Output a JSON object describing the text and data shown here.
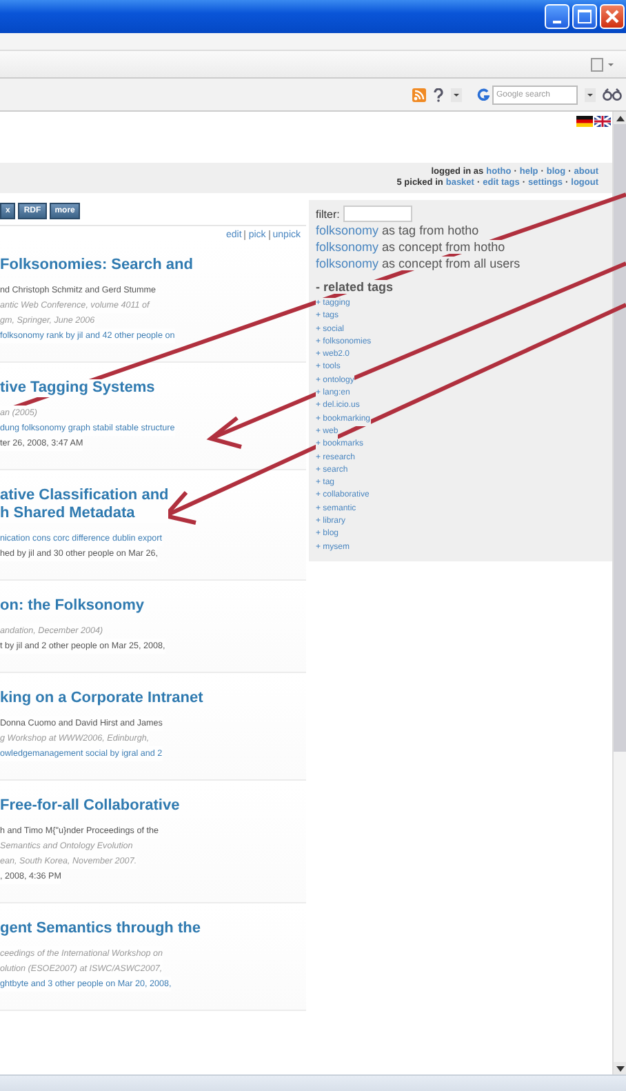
{
  "search": {
    "placeholder": "Google search"
  },
  "user_bar": [
    [
      {
        "text": "logged in as",
        "link": false
      },
      {
        "text": "hotho",
        "link": true
      },
      {
        "text": "·",
        "link": false
      },
      {
        "text": "help",
        "link": true
      },
      {
        "text": "·",
        "link": false
      },
      {
        "text": "blog",
        "link": true
      },
      {
        "text": "·",
        "link": false
      },
      {
        "text": "about",
        "link": true
      }
    ],
    [
      {
        "text": "5 picked in",
        "link": false
      },
      {
        "text": "basket",
        "link": true
      },
      {
        "text": "·",
        "link": false
      },
      {
        "text": "edit tags",
        "link": true
      },
      {
        "text": "·",
        "link": false
      },
      {
        "text": "settings",
        "link": true
      },
      {
        "text": "·",
        "link": false
      },
      {
        "text": "logout",
        "link": true
      }
    ]
  ],
  "export_buttons": [
    "x",
    "RDF",
    "more"
  ],
  "actions": [
    "edit",
    "pick",
    "unpick"
  ],
  "posts": [
    {
      "title": [
        "Folksonomies: Search and"
      ],
      "lines": [
        {
          "kind": "plain",
          "text": "nd Christoph Schmitz and Gerd Stumme"
        },
        {
          "kind": "italic",
          "text": "antic Web Conference, volume 4011 of"
        },
        {
          "kind": "italic",
          "text": "gm, Springer, June 2006"
        },
        {
          "kind": "link",
          "text": "folksonomy rank by jil and 42 other people on"
        }
      ]
    },
    {
      "title": [
        "tive Tagging Systems"
      ],
      "lines": [
        {
          "kind": "italic",
          "text": "an (2005)"
        },
        {
          "kind": "link",
          "text": "dung folksonomy graph stabil stable structure"
        },
        {
          "kind": "plain",
          "text": "ter 26, 2008, 3:47 AM"
        }
      ]
    },
    {
      "title": [
        "ative Classification and",
        "h Shared Metadata"
      ],
      "lines": [
        {
          "kind": "link",
          "text": "nication cons corc difference dublin export"
        },
        {
          "kind": "plain",
          "text": "hed by jil and 30 other people on Mar 26,"
        }
      ]
    },
    {
      "title": [
        "on: the Folksonomy"
      ],
      "lines": [
        {
          "kind": "italic",
          "text": "andation, December 2004)"
        },
        {
          "kind": "plain",
          "text": "t by jil and 2 other people on Mar 25, 2008,"
        }
      ]
    },
    {
      "title": [
        "king on a Corporate Intranet"
      ],
      "lines": [
        {
          "kind": "plain",
          "text": "Donna Cuomo and David Hirst and James"
        },
        {
          "kind": "italic",
          "text": "g Workshop at WWW2006, Edinburgh,"
        },
        {
          "kind": "link",
          "text": "owledgemanagement social by igral and 2"
        }
      ]
    },
    {
      "title": [
        "Free-for-all Collaborative"
      ],
      "lines": [
        {
          "kind": "plain",
          "text": "h and Timo M{\"u}nder Proceedings of the"
        },
        {
          "kind": "italic",
          "text": "Semantics and Ontology Evolution"
        },
        {
          "kind": "italic",
          "text": "ean, South Korea, November 2007."
        },
        {
          "kind": "plain",
          "text": ", 2008, 4:36 PM"
        }
      ]
    },
    {
      "title": [
        "gent Semantics through the"
      ],
      "lines": [
        {
          "kind": "italic",
          "text": "ceedings of the International Workshop on"
        },
        {
          "kind": "italic",
          "text": "olution (ESOE2007) at ISWC/ASWC2007,"
        },
        {
          "kind": "link",
          "text": "ghtbyte and 3 other people on Mar 20, 2008,"
        }
      ]
    }
  ],
  "sidebar": {
    "filter_label": "filter:",
    "concepts": [
      [
        "folksonomy",
        "as tag from hotho"
      ],
      [
        "folksonomy",
        "as concept from hotho"
      ],
      [
        "folksonomy",
        "as concept from all users"
      ]
    ],
    "related_heading": "- related tags",
    "related_tags": [
      "+ tagging",
      "+ tags",
      "+ social",
      "+ folksonomies",
      "+ web2.0",
      "+ tools",
      "+ ontology",
      "+ lang:en",
      "+ del.icio.us",
      "+ bookmarking",
      "+ web",
      "+ bookmarks",
      "+ research",
      "+ search",
      "+ tag",
      "+ collaborative",
      "+ semantic",
      "+ library",
      "+ blog",
      "+ mysem"
    ]
  }
}
